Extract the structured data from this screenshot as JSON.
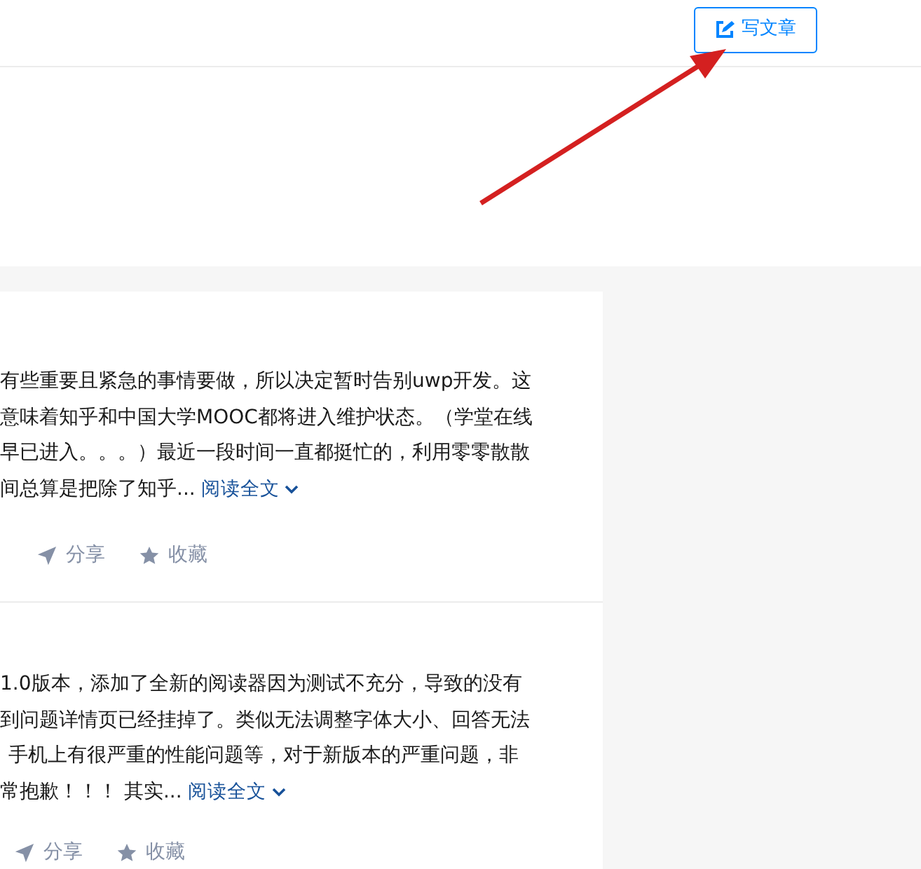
{
  "header": {
    "write_button": "写文章"
  },
  "posts": [
    {
      "lines": [
        "有些重要且紧急的事情要做，所以决定暂时告别uwp开发。这",
        "意味着知乎和中国大学MOOC都将进入维护状态。（学堂在线",
        "早已进入。。。）最近一段时间一直都挺忙的，利用零零散散",
        "间总算是把除了知乎..."
      ],
      "read_more": "阅读全文",
      "actions": [
        "分享",
        "收藏"
      ]
    },
    {
      "lines": [
        "1.0版本，添加了全新的阅读器因为测试不充分，导致的没有",
        "到问题详情页已经挂掉了。类似无法调整字体大小、回答无法",
        "手机上有很严重的性能问题等，对于新版本的严重问题，非",
        "常抱歉！！！ 其实..."
      ],
      "read_more": "阅读全文",
      "actions": [
        "分享",
        "收藏"
      ]
    }
  ]
}
